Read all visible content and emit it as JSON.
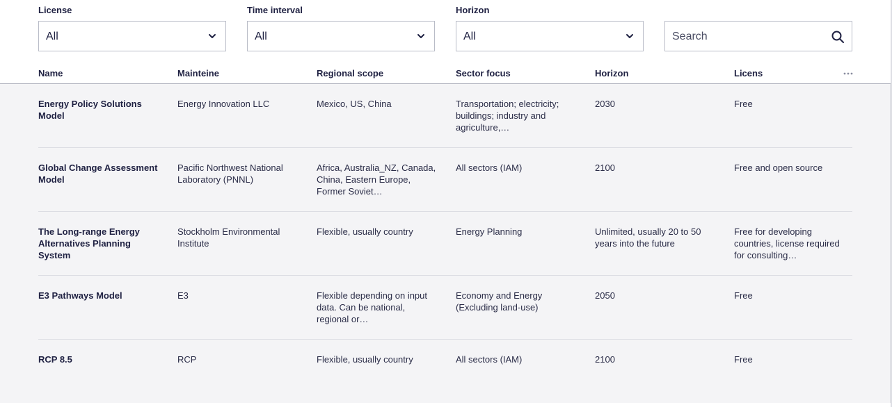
{
  "filters": {
    "license": {
      "label": "License",
      "value": "All"
    },
    "time_interval": {
      "label": "Time interval",
      "value": "All"
    },
    "horizon": {
      "label": "Horizon",
      "value": "All"
    },
    "search": {
      "placeholder": "Search"
    }
  },
  "table": {
    "columns": [
      "Name",
      "Mainteine",
      "Regional scope",
      "Sector focus",
      "Horizon",
      "Licens"
    ],
    "rows": [
      {
        "name": "Energy Policy Solutions Model",
        "maintainer": "Energy Innovation LLC",
        "regional_scope": "Mexico, US, China",
        "sector_focus": "Transportation; electricity; buildings; industry and agriculture,…",
        "horizon": "2030",
        "license": "Free"
      },
      {
        "name": "Global Change Assessment Model",
        "maintainer": "Pacific Northwest National Laboratory (PNNL)",
        "regional_scope": "Africa, Australia_NZ, Canada, China, Eastern Europe, Former Soviet…",
        "sector_focus": "All sectors (IAM)",
        "horizon": "2100",
        "license": "Free and open source"
      },
      {
        "name": "The Long-range Energy Alternatives Planning System",
        "maintainer": "Stockholm Environmental Institute",
        "regional_scope": "Flexible, usually country",
        "sector_focus": "Energy Planning",
        "horizon": "Unlimited, usually 20 to 50 years into the future",
        "license": "Free for developing countries, license required for consulting…"
      },
      {
        "name": "E3 Pathways Model",
        "maintainer": "E3",
        "regional_scope": "Flexible depending on input data. Can be national, regional or…",
        "sector_focus": "Economy and Energy (Excluding land-use)",
        "horizon": "2050",
        "license": "Free"
      },
      {
        "name": "RCP 8.5",
        "maintainer": "RCP",
        "regional_scope": "Flexible, usually country",
        "sector_focus": "All sectors (IAM)",
        "horizon": "2100",
        "license": "Free"
      }
    ]
  },
  "icons": {
    "dropdown": "chevron-down-icon",
    "search": "search-icon",
    "more": "more-horizontal-icon"
  }
}
